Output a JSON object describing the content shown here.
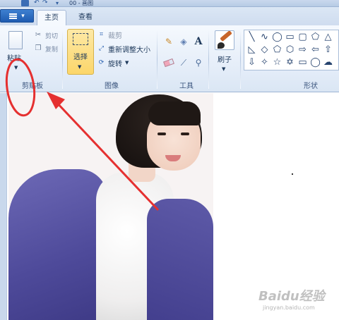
{
  "title_bar": {
    "title": "00 - 画图"
  },
  "tabs": [
    {
      "label": "主页"
    },
    {
      "label": "查看"
    }
  ],
  "clipboard": {
    "paste_label": "粘贴",
    "cut_label": "剪切",
    "copy_label": "复制",
    "group_label": "剪贴板"
  },
  "image": {
    "select_label": "选择",
    "crop_label": "裁剪",
    "resize_label": "重新调整大小",
    "rotate_label": "旋转",
    "group_label": "图像"
  },
  "tools": {
    "group_label": "工具"
  },
  "brushes": {
    "label": "刷子"
  },
  "shapes": {
    "group_label": "形状"
  },
  "watermark": {
    "text": "Baidu经验",
    "sub": "jingyan.baidu.com"
  },
  "colors": {
    "ribbon_bg": "#e3ecf8",
    "select_highlight": "#fcd66a",
    "annotation": "#e53030",
    "sweater": "#5a56a6"
  }
}
